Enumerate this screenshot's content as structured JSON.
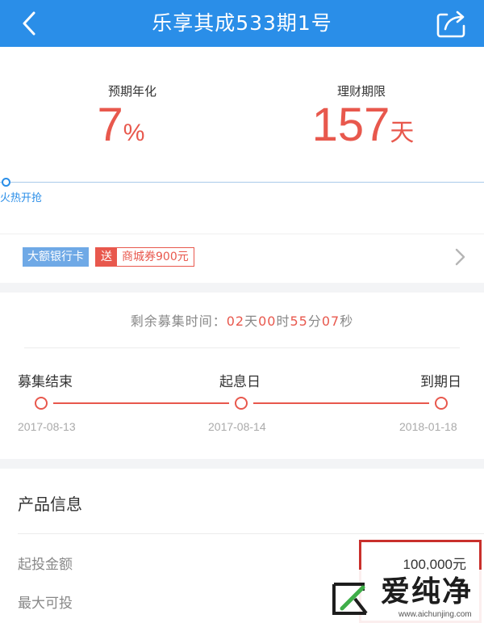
{
  "header": {
    "title": "乐享其成533期1号",
    "back_icon": "chevron-left-icon",
    "share_icon": "share-icon",
    "bg_color": "#2a8ee8"
  },
  "summary": {
    "rate_label": "预期年化",
    "rate_value": "7",
    "rate_unit": "%",
    "term_label": "理财期限",
    "term_value": "157",
    "term_unit": "天",
    "accent_color": "#e8584d"
  },
  "progress": {
    "status_text": "火热开抢",
    "fraction": 0
  },
  "promo": {
    "bank_tag": "大额银行卡",
    "gift_prefix": "送",
    "gift_text": "商城券900元"
  },
  "countdown": {
    "prefix": "剩余募集时间：",
    "days": "02",
    "days_unit": "天",
    "hours": "00",
    "hours_unit": "时",
    "minutes": "55",
    "minutes_unit": "分",
    "seconds": "07",
    "seconds_unit": "秒"
  },
  "timeline": {
    "nodes": [
      {
        "label": "募集结束",
        "date": "2017-08-13"
      },
      {
        "label": "起息日",
        "date": "2017-08-14"
      },
      {
        "label": "到期日",
        "date": "2018-01-18"
      }
    ]
  },
  "product_info": {
    "title": "产品信息",
    "rows": [
      {
        "label": "起投金额",
        "value": "100,000元"
      },
      {
        "label": "最大可投",
        "value": ""
      }
    ]
  },
  "watermark": {
    "text": "爱纯净",
    "url": "www.aichunjing.com"
  }
}
